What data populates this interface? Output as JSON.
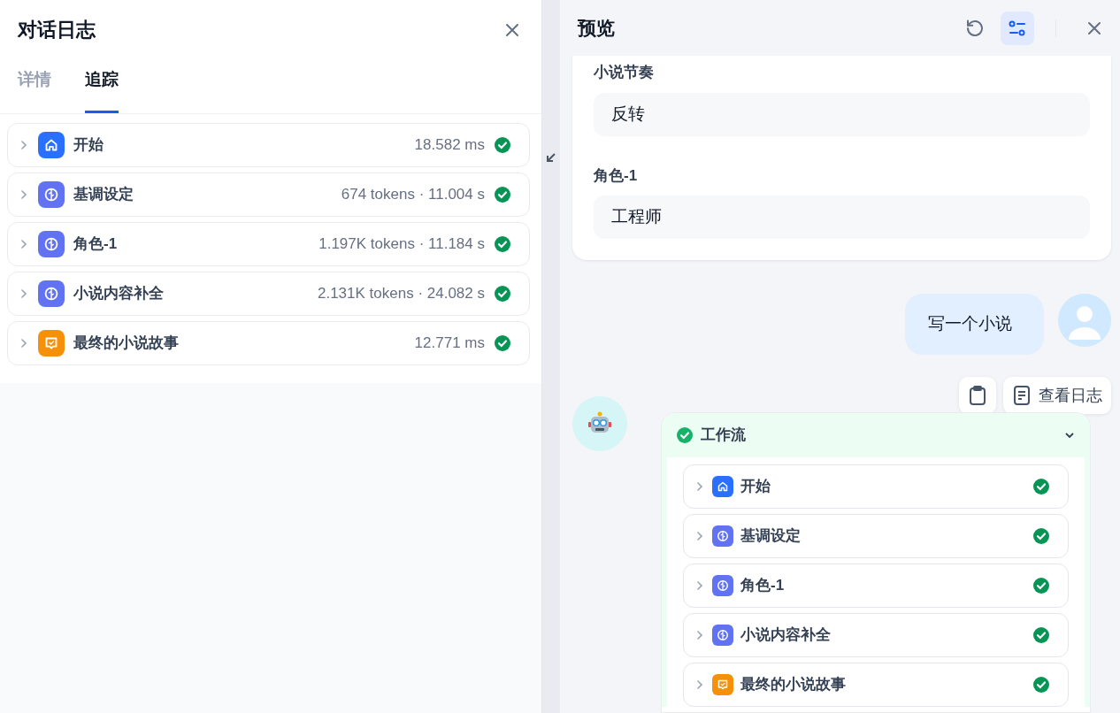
{
  "log_panel": {
    "title": "对话日志",
    "tabs": [
      {
        "label": "详情",
        "selected": false
      },
      {
        "label": "追踪",
        "selected": true
      }
    ],
    "trace": [
      {
        "kind": "start",
        "name": "开始",
        "meta": "18.582 ms"
      },
      {
        "kind": "llm",
        "name": "基调设定",
        "meta": "674 tokens · 11.004 s"
      },
      {
        "kind": "llm",
        "name": "角色-1",
        "meta": "1.197K tokens · 11.184 s"
      },
      {
        "kind": "llm",
        "name": "小说内容补全",
        "meta": "2.131K tokens · 24.082 s"
      },
      {
        "kind": "answer",
        "name": "最终的小说故事",
        "meta": "12.771 ms"
      }
    ]
  },
  "preview": {
    "title": "预览",
    "settings_active": true,
    "inputs": [
      {
        "label": "小说节奏",
        "value": "反转"
      },
      {
        "label": "角色-1",
        "value": "工程师"
      }
    ],
    "user_message": "写一个小说",
    "actions": [
      {
        "kind": "copy"
      },
      {
        "kind": "log",
        "label": "查看日志"
      }
    ],
    "workflow": {
      "title": "工作流",
      "expanded": true,
      "nodes": [
        {
          "kind": "start",
          "name": "开始"
        },
        {
          "kind": "llm",
          "name": "基调设定"
        },
        {
          "kind": "llm",
          "name": "角色-1"
        },
        {
          "kind": "llm",
          "name": "小说内容补全"
        },
        {
          "kind": "answer",
          "name": "最终的小说故事"
        }
      ]
    }
  }
}
